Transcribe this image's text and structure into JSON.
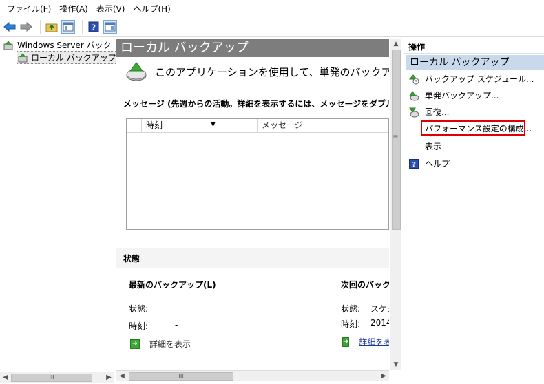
{
  "menu": [
    "ファイル(F)",
    "操作(A)",
    "表示(V)",
    "ヘルプ(H)"
  ],
  "tree": {
    "root": "Windows Server バックアップ",
    "child": "ローカル バックアップ"
  },
  "center": {
    "title": "ローカル バックアップ",
    "intro": "このアプリケーションを使用して、単発のバックアップを実行",
    "messages_title": "メッセージ (先週からの活動。詳細を表示するには、メッセージをダブルクリックします)",
    "messages_columns": [
      "時刻",
      "メッセージ"
    ],
    "status_title": "状態",
    "latest": {
      "title": "最新のバックアップ(L)",
      "status_label": "状態:",
      "status_value": "-",
      "time_label": "時刻:",
      "time_value": "-",
      "link": "詳細を表示"
    },
    "next": {
      "title": "次回のバックアップ",
      "status_label": "状態:",
      "status_value": "スケジュール",
      "time_label": "時刻:",
      "time_value": "2014",
      "link": "詳細を表示"
    }
  },
  "actions": {
    "header": "操作",
    "section": "ローカル バックアップ",
    "items": [
      "バックアップ スケジュール...",
      "単発バックアップ...",
      "回復...",
      "パフォーマンス設定の構成...",
      "表示",
      "ヘルプ"
    ],
    "highlight_color": "#e00000"
  },
  "scroll": {
    "grip": "III"
  }
}
